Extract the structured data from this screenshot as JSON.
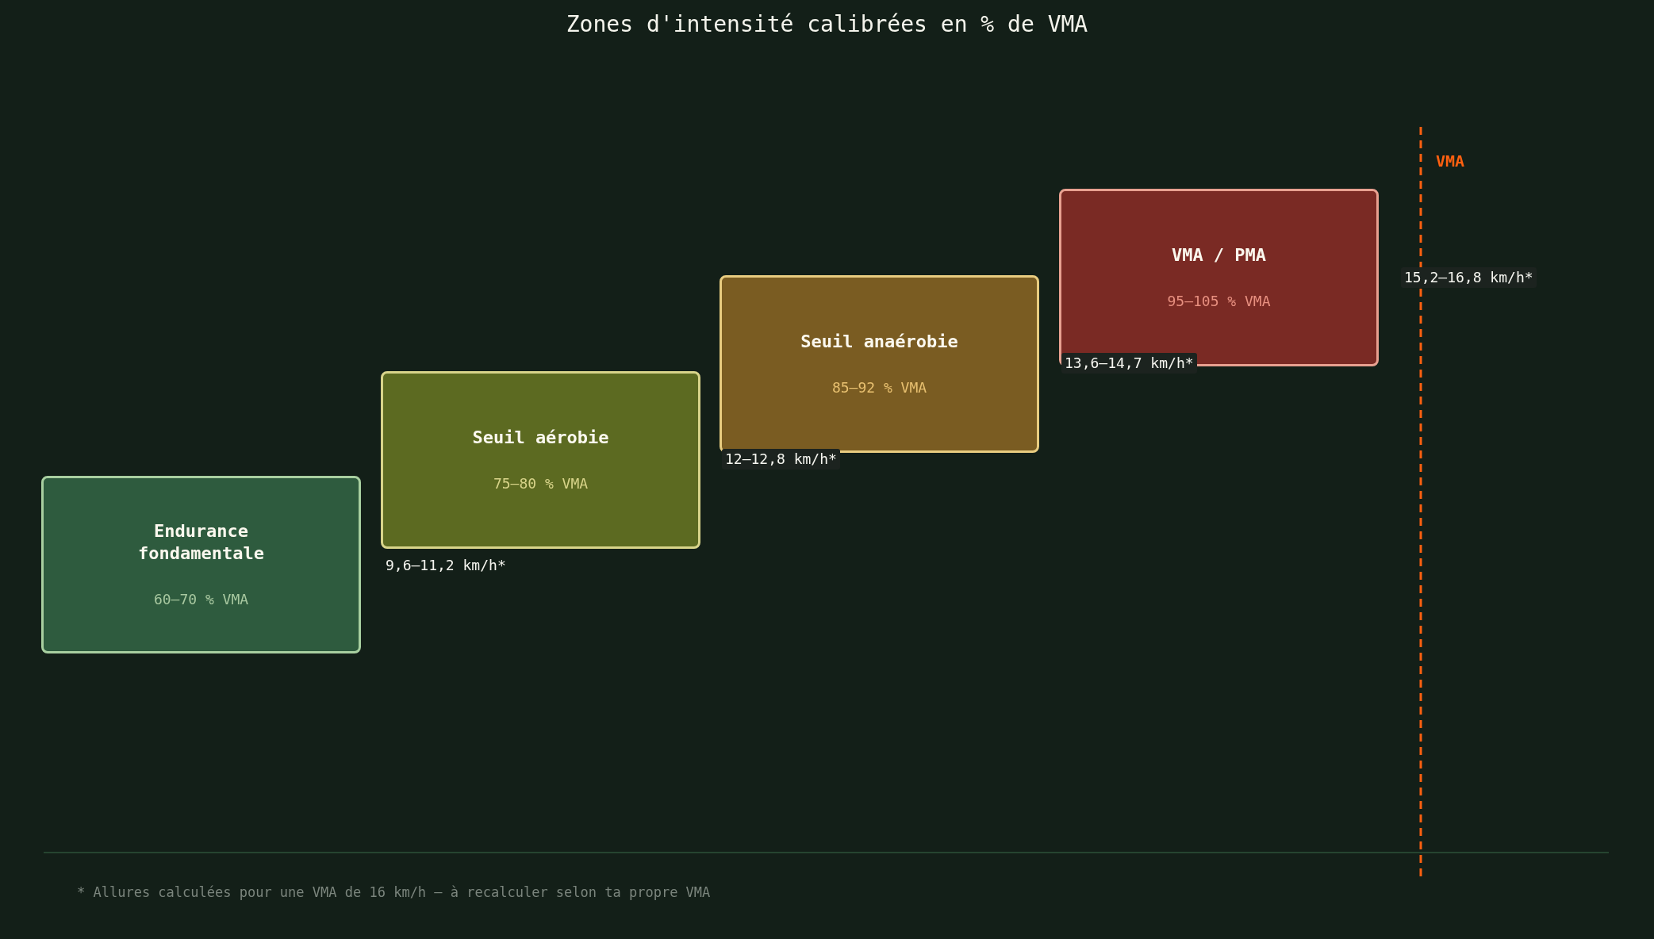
{
  "title": "Zones d'intensité calibrées en % de VMA",
  "zones": [
    {
      "name": "Endurance fondamentale",
      "percent": "60–70 % VMA",
      "speed": "9,6–11,2 km/h*",
      "color": "#2e5b3e"
    },
    {
      "name": "Seuil aérobie",
      "percent": "75–80 % VMA",
      "speed": "12–12,8 km/h*",
      "color": "#5c6a21"
    },
    {
      "name": "Seuil anaérobie",
      "percent": "85–92 % VMA",
      "speed": "13,6–14,7 km/h*",
      "color": "#7a5c22"
    },
    {
      "name": "VMA / PMA",
      "percent": "95–105 % VMA",
      "speed": "15,2–16,8 km/h*",
      "color": "#7a2a24"
    }
  ],
  "vma_marker": {
    "label": "VMA"
  },
  "footnote": "* Allures calculées pour une VMA de 16 km/h – à recalculer selon ta propre VMA"
}
